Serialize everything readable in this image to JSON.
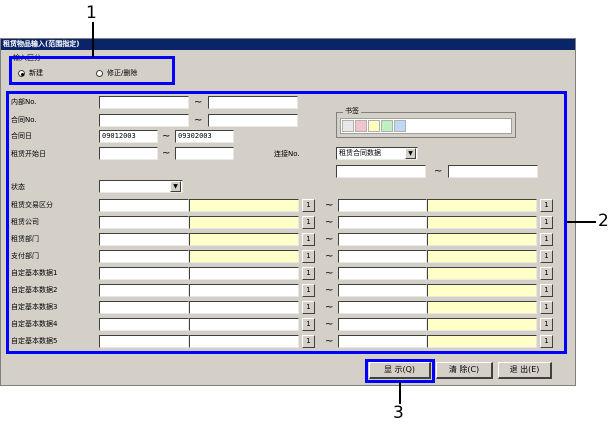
{
  "window": {
    "title": "租赁物品输入(范围指定)"
  },
  "input_type": {
    "label": "输入区分",
    "options": [
      "新建",
      "修正/删除"
    ],
    "selected": "新建"
  },
  "fields": {
    "internal_no": {
      "label": "内部No.",
      "from": "",
      "to": ""
    },
    "contract_no": {
      "label": "合同No.",
      "from": "",
      "to": ""
    },
    "contract_date": {
      "label": "合同日",
      "from": "09012003",
      "to": "09302003"
    },
    "lease_start": {
      "label": "租赁开始日",
      "from": "",
      "to": ""
    },
    "status": {
      "label": "状态",
      "value": ""
    }
  },
  "tilde": "~",
  "bookmark": {
    "label": "书签",
    "colors": [
      "#f4c4cc",
      "#ffffc0",
      "#c0f0c0",
      "#c0d8f4"
    ]
  },
  "link_no": {
    "label": "连接No.",
    "select_value": "租赁合同数据",
    "from": "",
    "to": ""
  },
  "rows": [
    {
      "label": "租赁交易区分"
    },
    {
      "label": "租赁公司"
    },
    {
      "label": "租赁部门"
    },
    {
      "label": "支付部门"
    },
    {
      "label": "自定基本数据1"
    },
    {
      "label": "自定基本数据2"
    },
    {
      "label": "自定基本数据3"
    },
    {
      "label": "自定基本数据4"
    },
    {
      "label": "自定基本数据5"
    }
  ],
  "lookup_button_label": "1",
  "buttons": {
    "display": "显 示(Q)",
    "clear": "清 除(C)",
    "exit": "退 出(E)"
  },
  "callouts": {
    "c1": "1",
    "c2": "2",
    "c3": "3"
  }
}
